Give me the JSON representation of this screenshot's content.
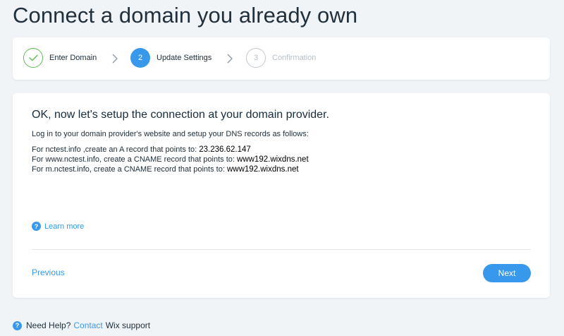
{
  "page": {
    "title": "Connect a domain you already own"
  },
  "stepper": {
    "steps": [
      {
        "number": "",
        "label": "Enter Domain",
        "state": "done"
      },
      {
        "number": "2",
        "label": "Update Settings",
        "state": "active"
      },
      {
        "number": "3",
        "label": "Confirmation",
        "state": "pending"
      }
    ]
  },
  "card": {
    "heading": "OK, now let's setup the connection at your domain provider.",
    "intro": "Log in to your domain provider's website and setup your DNS records as follows:",
    "records": [
      {
        "text": "For nctest.info ,create an A record that points to: ",
        "value": "23.236.62.147"
      },
      {
        "text": "For  www.nctest.info, create a CNAME record that points to: ",
        "value": "www192.wixdns.net"
      },
      {
        "text": "For m.nctest.info, create a CNAME record that points to: ",
        "value": "www192.wixdns.net"
      }
    ],
    "learn_more": "Learn more",
    "previous_label": "Previous",
    "next_label": "Next"
  },
  "footer": {
    "need_help": "Need Help?",
    "contact": "Contact",
    "wix_support": "Wix support"
  },
  "colors": {
    "accent": "#3899ec",
    "success": "#60bc57",
    "background": "#f0f4f7"
  },
  "icons": {
    "done": "checkmark-icon",
    "chevron": "chevron-right-icon",
    "help": "question-circle-icon"
  }
}
